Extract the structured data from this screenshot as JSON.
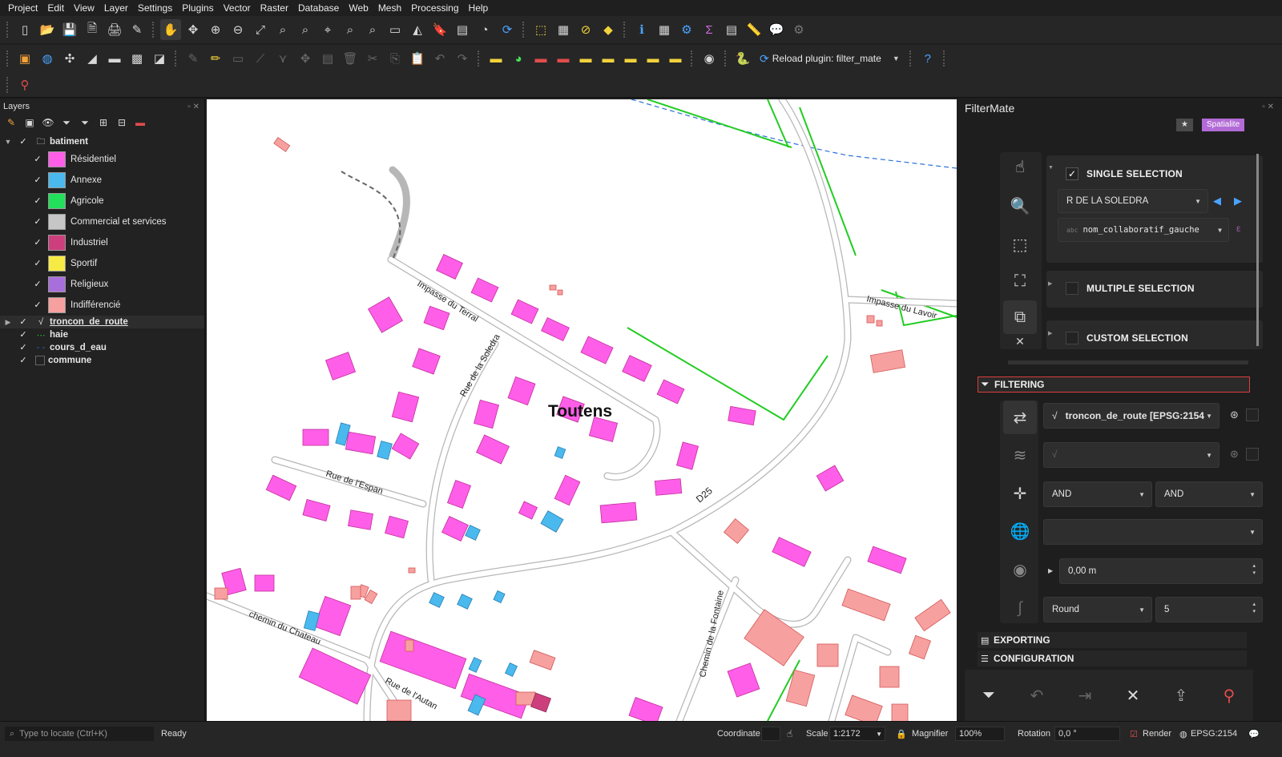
{
  "menu": [
    "Project",
    "Edit",
    "View",
    "Layer",
    "Settings",
    "Plugins",
    "Vector",
    "Raster",
    "Database",
    "Web",
    "Mesh",
    "Processing",
    "Help"
  ],
  "toolbar2": {
    "reload_label": "Reload plugin: filter_mate"
  },
  "layers_panel": {
    "title": "Layers",
    "group": {
      "name": "batiment",
      "items": [
        {
          "label": "Résidentiel",
          "color": "#ff5ee8"
        },
        {
          "label": "Annexe",
          "color": "#4ab9ee"
        },
        {
          "label": "Agricole",
          "color": "#22e05a"
        },
        {
          "label": "Commercial et services",
          "color": "#c6c6c6"
        },
        {
          "label": "Industriel",
          "color": "#cc3f7c"
        },
        {
          "label": "Sportif",
          "color": "#f7ea44"
        },
        {
          "label": "Religieux",
          "color": "#a86fdc"
        },
        {
          "label": "Indifférencié",
          "color": "#f7a0a0"
        }
      ]
    },
    "layers": [
      {
        "name": "troncon_de_route"
      },
      {
        "name": "haie"
      },
      {
        "name": "cours_d_eau"
      },
      {
        "name": "commune"
      }
    ]
  },
  "map": {
    "place": "Toutens",
    "roads": [
      "Impasse du Terral",
      "Rue de la Soledra",
      "Rue de l'Espan",
      "D25",
      "Impasse du Lavoir",
      "chemin du Chateau",
      "Rue de l'Autan",
      "Chemin de la Fontaine"
    ]
  },
  "filtermate": {
    "title": "FilterMate",
    "badge_star": "★",
    "badge_backend": "Spatialite",
    "single_selection": "SINGLE SELECTION",
    "single_value": "R DE LA SOLEDRA",
    "single_field": "nom_collaboratif_gauche",
    "single_field_prefix": "abc",
    "multiple_selection": "MULTIPLE SELECTION",
    "custom_selection": "CUSTOM SELECTION",
    "filtering": "FILTERING",
    "layer_source": "troncon_de_route [EPSG:2154",
    "combine_op1": "AND",
    "combine_op2": "AND",
    "buffer_value": "0,00 m",
    "buffer_style": "Round",
    "segments": "5",
    "exporting": "EXPORTING",
    "configuration": "CONFIGURATION"
  },
  "status": {
    "locate_placeholder": "Type to locate (Ctrl+K)",
    "ready": "Ready",
    "coordinate_label": "Coordinate",
    "scale_label": "Scale",
    "scale_value": "1:2172",
    "magnifier_label": "Magnifier",
    "magnifier_value": "100%",
    "rotation_label": "Rotation",
    "rotation_value": "0,0 °",
    "render_label": "Render",
    "crs": "EPSG:2154"
  }
}
